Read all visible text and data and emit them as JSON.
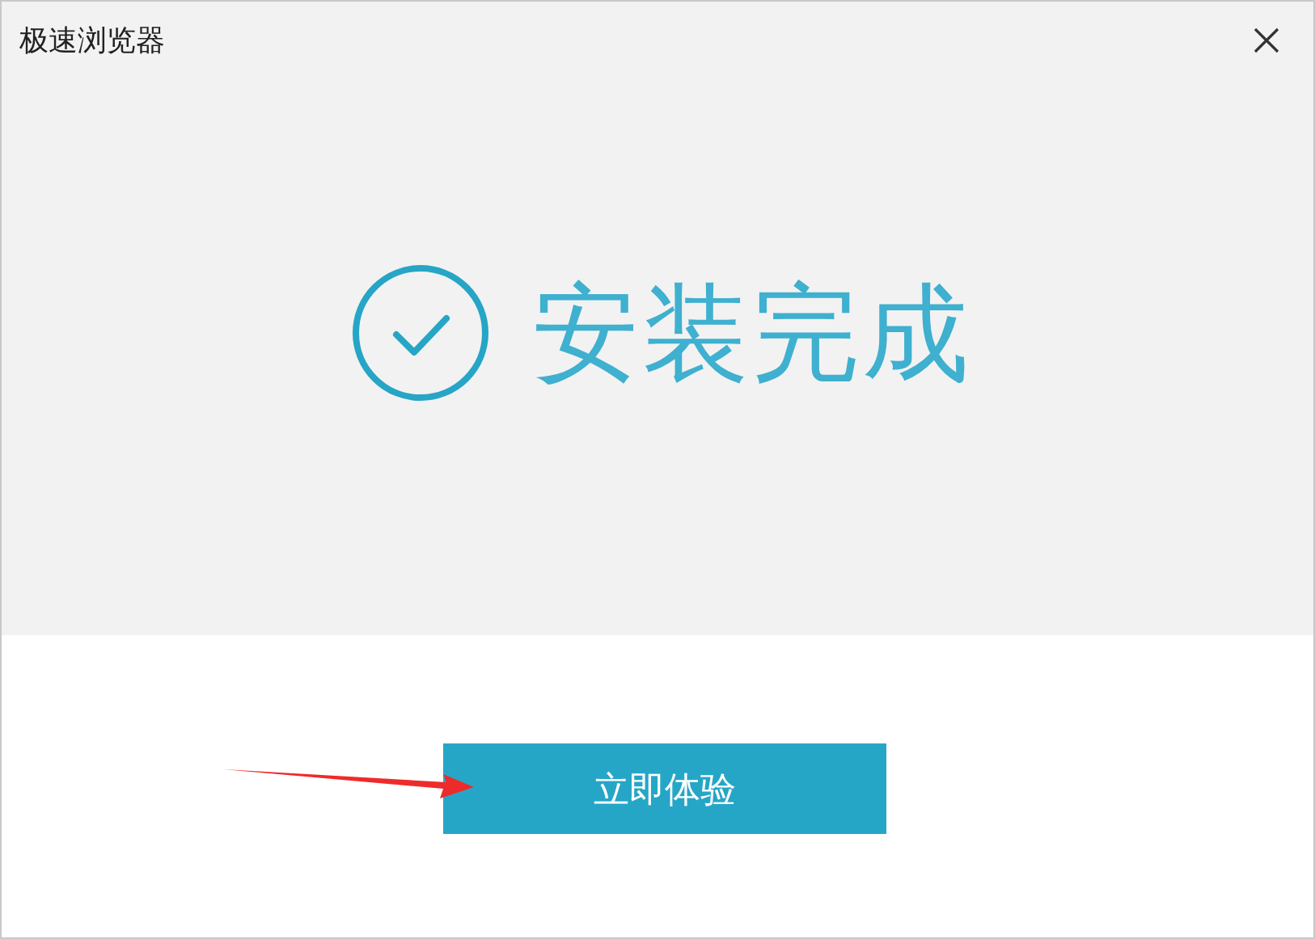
{
  "window": {
    "title": "极速浏览器"
  },
  "status": {
    "message": "安装完成"
  },
  "primary_button": {
    "label": "立即体验"
  }
}
